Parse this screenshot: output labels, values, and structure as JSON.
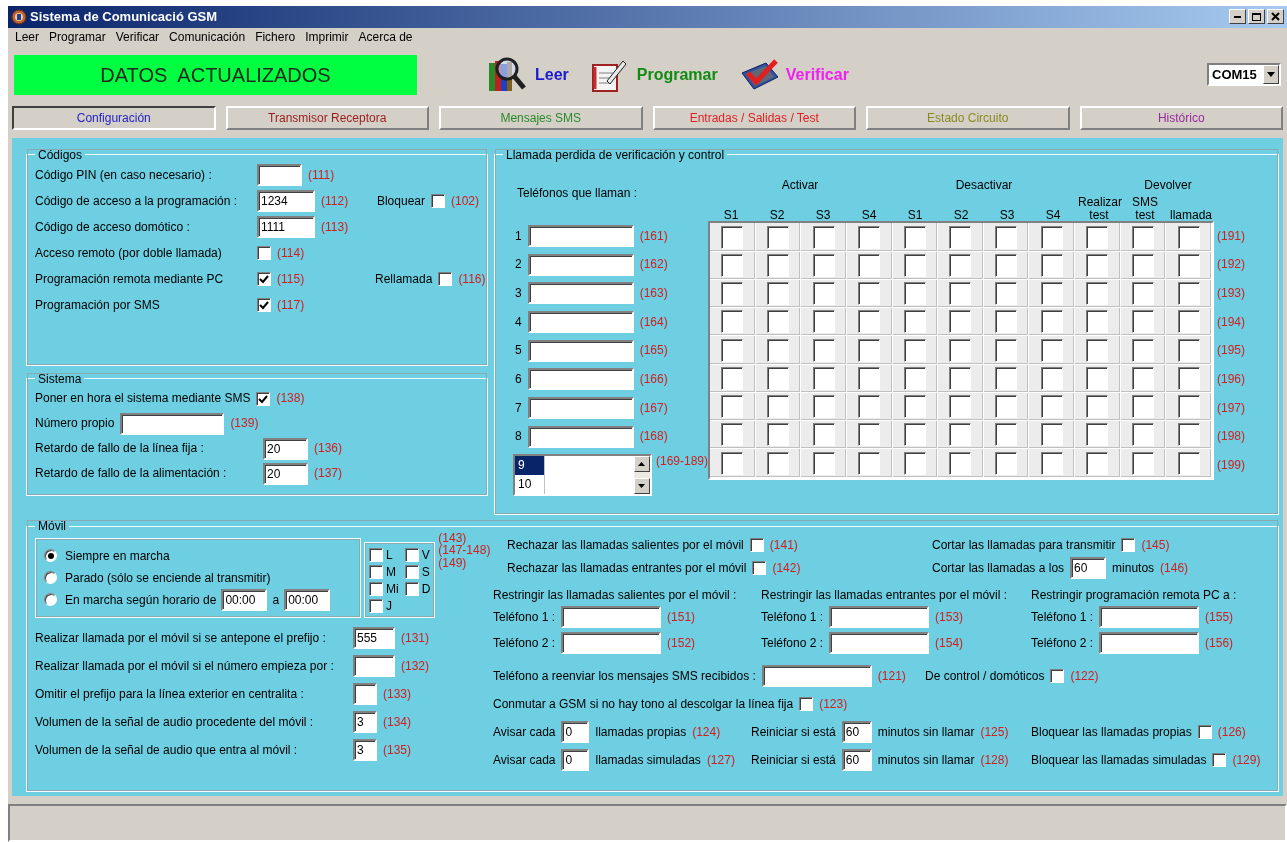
{
  "window": {
    "title": "Sistema de Comunicació GSM"
  },
  "menu": [
    "Leer",
    "Programar",
    "Verificar",
    "Comunicación",
    "Fichero",
    "Imprimir",
    "Acerca de"
  ],
  "status_banner": "DATOS  ACTUALIZADOS",
  "toolbar": [
    {
      "kind": "read",
      "label": "Leer",
      "color": "#1a1ad0"
    },
    {
      "kind": "program",
      "label": "Programar",
      "color": "#138a13"
    },
    {
      "kind": "verify",
      "label": "Verificar",
      "color": "#ee22ee"
    }
  ],
  "port": "COM15",
  "tabs": [
    {
      "label": "Configuración",
      "selected": true,
      "color": "#2323c8"
    },
    {
      "label": "Transmisor Receptora",
      "selected": false,
      "color": "#9b1c1c"
    },
    {
      "label": "Mensajes SMS",
      "selected": false,
      "color": "#2a8a2a"
    },
    {
      "label": "Entradas / Salidas / Test",
      "selected": false,
      "color": "#e02020"
    },
    {
      "label": "Estado Circuito",
      "selected": false,
      "color": "#8a8a20"
    },
    {
      "label": "Histórico",
      "selected": false,
      "color": "#9a2aa0"
    }
  ],
  "codigos": {
    "title": "Códigos",
    "rows": [
      [
        [
          {
            "kind": "label",
            "text": "Código PIN (en caso necesario) :"
          }
        ],
        [
          {
            "kind": "field"
          },
          {
            "kind": "code",
            "text": "(111)"
          }
        ]
      ],
      [
        [
          {
            "kind": "label",
            "text": "Código de acceso a la programación :"
          }
        ],
        [
          {
            "kind": "field",
            "value": "1234"
          },
          {
            "kind": "code",
            "text": "(112)"
          }
        ],
        [
          {
            "kind": "label",
            "text": "Bloquear"
          },
          {
            "kind": "check",
            "checked": false
          },
          {
            "kind": "code",
            "text": "(102)"
          }
        ]
      ],
      [
        [
          {
            "kind": "label",
            "text": "Código de acceso domótico :"
          }
        ],
        [
          {
            "kind": "field",
            "value": "1111"
          },
          {
            "kind": "code",
            "text": "(113)"
          }
        ]
      ],
      [
        [
          {
            "kind": "label",
            "text": "Acceso remoto (por doble llamada)"
          }
        ],
        [
          {
            "kind": "check",
            "checked": false
          },
          {
            "kind": "code",
            "text": "(114)"
          }
        ]
      ],
      [
        [
          {
            "kind": "label",
            "text": "Programación remota mediante PC"
          }
        ],
        [
          {
            "kind": "check",
            "checked": true
          },
          {
            "kind": "code",
            "text": "(115)"
          }
        ],
        [
          {
            "kind": "label",
            "text": "Rellamada"
          },
          {
            "kind": "check",
            "checked": false
          },
          {
            "kind": "code",
            "text": "(116)"
          }
        ]
      ],
      [
        [
          {
            "kind": "label",
            "text": "Programación por SMS"
          }
        ],
        [
          {
            "kind": "check",
            "checked": true
          },
          {
            "kind": "code",
            "text": "(117)"
          }
        ]
      ]
    ]
  },
  "sistema": {
    "title": "Sistema",
    "rows": [
      [
        [
          {
            "kind": "label",
            "text": "Poner en hora el sistema mediante SMS"
          },
          {
            "kind": "check",
            "checked": true
          },
          {
            "kind": "code",
            "text": "(138)"
          }
        ]
      ],
      [
        [
          {
            "kind": "label",
            "text": "Número propio"
          },
          {
            "kind": "field"
          },
          {
            "kind": "code",
            "text": "(139)"
          }
        ]
      ],
      [
        [
          {
            "kind": "label",
            "text": "Retardo de fallo de la línea fija :"
          }
        ],
        [
          {
            "kind": "field",
            "value": "20"
          },
          {
            "kind": "code",
            "text": "(136)"
          }
        ]
      ],
      [
        [
          {
            "kind": "label",
            "text": "Retardo de fallo de la alimentación :"
          }
        ],
        [
          {
            "kind": "field",
            "value": "20"
          },
          {
            "kind": "code",
            "text": "(137)"
          }
        ]
      ]
    ]
  },
  "llamada": {
    "title": "Llamada perdida de verificación y control",
    "phones_label": "Teléfonos que llaman :",
    "groups": [
      {
        "label": "Activar",
        "columns": [
          "S1",
          "S2",
          "S3",
          "S4"
        ]
      },
      {
        "label": "Desactivar",
        "columns": [
          "S1",
          "S2",
          "S3",
          "S4"
        ]
      },
      {
        "columns": [
          "Realizar test"
        ]
      },
      {
        "label": "Devolver",
        "columns": [
          "SMS test",
          "llamada"
        ]
      }
    ],
    "phones": [
      {
        "number": "1",
        "code": "(161)"
      },
      {
        "number": "2",
        "code": "(162)"
      },
      {
        "number": "3",
        "code": "(163)"
      },
      {
        "number": "4",
        "code": "(164)"
      },
      {
        "number": "5",
        "code": "(165)"
      },
      {
        "number": "6",
        "code": "(166)"
      },
      {
        "number": "7",
        "code": "(167)"
      },
      {
        "number": "8",
        "code": "(168)"
      }
    ],
    "list": {
      "items": [
        {
          "text": "9",
          "selected": true
        },
        {
          "text": "10",
          "selected": false
        }
      ],
      "code": "(169-189)"
    },
    "matrix": [
      {
        "checks": [
          false,
          false,
          false,
          false,
          false,
          false,
          false,
          false,
          false,
          false,
          false
        ],
        "code": "(191)"
      },
      {
        "checks": [
          false,
          false,
          false,
          false,
          false,
          false,
          false,
          false,
          false,
          false,
          false
        ],
        "code": "(192)"
      },
      {
        "checks": [
          false,
          false,
          false,
          false,
          false,
          false,
          false,
          false,
          false,
          false,
          false
        ],
        "code": "(193)"
      },
      {
        "checks": [
          false,
          false,
          false,
          false,
          false,
          false,
          false,
          false,
          false,
          false,
          false
        ],
        "code": "(194)"
      },
      {
        "checks": [
          false,
          false,
          false,
          false,
          false,
          false,
          false,
          false,
          false,
          false,
          false
        ],
        "code": "(195)"
      },
      {
        "checks": [
          false,
          false,
          false,
          false,
          false,
          false,
          false,
          false,
          false,
          false,
          false
        ],
        "code": "(196)"
      },
      {
        "checks": [
          false,
          false,
          false,
          false,
          false,
          false,
          false,
          false,
          false,
          false,
          false
        ],
        "code": "(197)"
      },
      {
        "checks": [
          false,
          false,
          false,
          false,
          false,
          false,
          false,
          false,
          false,
          false,
          false
        ],
        "code": "(198)"
      },
      {
        "checks": [
          false,
          false,
          false,
          false,
          false,
          false,
          false,
          false,
          false,
          false,
          false
        ],
        "code": "(199)"
      }
    ]
  },
  "movil": {
    "title": "Móvil",
    "power": [
      {
        "text": "Siempre en marcha",
        "selected": true
      },
      {
        "text": "Parado (sólo se enciende al transmitir)",
        "selected": false
      },
      {
        "text": "En marcha según horario de",
        "selected": false,
        "extra": [
          {
            "kind": "field",
            "value": "00:00"
          },
          {
            "kind": "label",
            "text": "a"
          },
          {
            "kind": "field",
            "value": "00:00"
          }
        ]
      }
    ],
    "days": [
      {
        "text": "L",
        "checked": false
      },
      {
        "text": "V",
        "checked": false
      },
      {
        "text": "M",
        "checked": false
      },
      {
        "text": "S",
        "checked": false
      },
      {
        "text": "Mi",
        "checked": false
      },
      {
        "text": "D",
        "checked": false
      },
      {
        "text": "J",
        "checked": false
      }
    ],
    "day_codes": [
      "(143)",
      "(147-148)",
      "(149)"
    ],
    "rows": [
      [
        [
          {
            "kind": "label",
            "text": "Realizar llamada por el móvil si se antepone el prefijo :"
          }
        ],
        [
          {
            "kind": "field",
            "value": "555"
          },
          {
            "kind": "code",
            "text": "(131)"
          }
        ]
      ],
      [
        [
          {
            "kind": "label",
            "text": "Realizar llamada por el móvil si el número empieza por :"
          }
        ],
        [
          {
            "kind": "field"
          },
          {
            "kind": "code",
            "text": "(132)"
          }
        ]
      ],
      [
        [
          {
            "kind": "label",
            "text": "Omitir el prefijo para la línea exterior en centralita :"
          }
        ],
        [
          {
            "kind": "field"
          },
          {
            "kind": "code",
            "text": "(133)"
          }
        ]
      ],
      [
        [
          {
            "kind": "label",
            "text": "Volumen de la señal de audio procedente del móvil :"
          }
        ],
        [
          {
            "kind": "field",
            "value": "3"
          },
          {
            "kind": "code",
            "text": "(134)"
          }
        ]
      ],
      [
        [
          {
            "kind": "label",
            "text": "Volumen de la señal de audio que entra al móvil :"
          }
        ],
        [
          {
            "kind": "field",
            "value": "3"
          },
          {
            "kind": "code",
            "text": "(135)"
          }
        ]
      ]
    ],
    "right_top": [
      [
        [
          {
            "kind": "label",
            "text": "Rechazar las llamadas salientes por el móvil"
          },
          {
            "kind": "check",
            "checked": false
          },
          {
            "kind": "code",
            "text": "(141)"
          }
        ],
        [
          {
            "kind": "label",
            "text": "Cortar las llamadas para transmitir"
          },
          {
            "kind": "check",
            "checked": false
          },
          {
            "kind": "code",
            "text": "(145)"
          }
        ]
      ],
      [
        [
          {
            "kind": "label",
            "text": "Rechazar las llamadas entrantes por el móvil"
          },
          {
            "kind": "check",
            "checked": false
          },
          {
            "kind": "code",
            "text": "(142)"
          }
        ],
        [
          {
            "kind": "label",
            "text": "Cortar las llamadas a los"
          },
          {
            "kind": "field",
            "value": "60"
          },
          {
            "kind": "label",
            "text": "minutos"
          },
          {
            "kind": "code",
            "text": "(146)"
          }
        ]
      ]
    ],
    "restrictions": [
      {
        "title": "Restringir las llamadas salientes por el móvil :",
        "phones": [
          {
            "label": "Teléfono 1 :",
            "code": "(151)"
          },
          {
            "label": "Teléfono 2 :",
            "code": "(152)"
          }
        ]
      },
      {
        "title": "Restringir las llamadas entrantes por el móvil :",
        "phones": [
          {
            "label": "Teléfono 1 :",
            "code": "(153)"
          },
          {
            "label": "Teléfono 2 :",
            "code": "(154)"
          }
        ]
      },
      {
        "title": "Restringir programación remota PC a :",
        "phones": [
          {
            "label": "Teléfono 1 :",
            "code": "(155)"
          },
          {
            "label": "Teléfono 2 :",
            "code": "(156)"
          }
        ]
      }
    ],
    "right_bottom": [
      [
        [
          {
            "kind": "label",
            "text": "Teléfono a reenviar los mensajes SMS recibidos :"
          },
          {
            "kind": "field"
          },
          {
            "kind": "code",
            "text": "(121)"
          }
        ],
        [
          {
            "kind": "label",
            "text": "De control / domóticos"
          },
          {
            "kind": "check",
            "checked": false
          },
          {
            "kind": "code",
            "text": "(122)"
          }
        ]
      ],
      [
        [
          {
            "kind": "label",
            "text": "Conmutar a GSM si no hay tono al descolgar la línea fija"
          },
          {
            "kind": "check",
            "checked": false
          },
          {
            "kind": "code",
            "text": "(123)"
          }
        ]
      ],
      [
        [
          {
            "kind": "label",
            "text": "Avisar cada"
          },
          {
            "kind": "field",
            "value": "0"
          },
          {
            "kind": "label",
            "text": "llamadas propias"
          },
          {
            "kind": "code",
            "text": "(124)"
          }
        ],
        [
          {
            "kind": "label",
            "text": "Reiniciar si está"
          },
          {
            "kind": "field",
            "value": "60"
          },
          {
            "kind": "label",
            "text": "minutos sin llamar"
          },
          {
            "kind": "code",
            "text": "(125)"
          }
        ],
        [
          {
            "kind": "label",
            "text": "Bloquear las llamadas propias"
          },
          {
            "kind": "check",
            "checked": false
          },
          {
            "kind": "code",
            "text": "(126)"
          }
        ]
      ],
      [
        [
          {
            "kind": "label",
            "text": "Avisar cada"
          },
          {
            "kind": "field",
            "value": "0"
          },
          {
            "kind": "label",
            "text": "llamadas simuladas"
          },
          {
            "kind": "code",
            "text": "(127)"
          }
        ],
        [
          {
            "kind": "label",
            "text": "Reiniciar si está"
          },
          {
            "kind": "field",
            "value": "60"
          },
          {
            "kind": "label",
            "text": "minutos sin llamar"
          },
          {
            "kind": "code",
            "text": "(128)"
          }
        ],
        [
          {
            "kind": "label",
            "text": "Bloquear las llamadas simuladas"
          },
          {
            "kind": "check",
            "checked": false
          },
          {
            "kind": "code",
            "text": "(129)"
          }
        ]
      ]
    ]
  }
}
